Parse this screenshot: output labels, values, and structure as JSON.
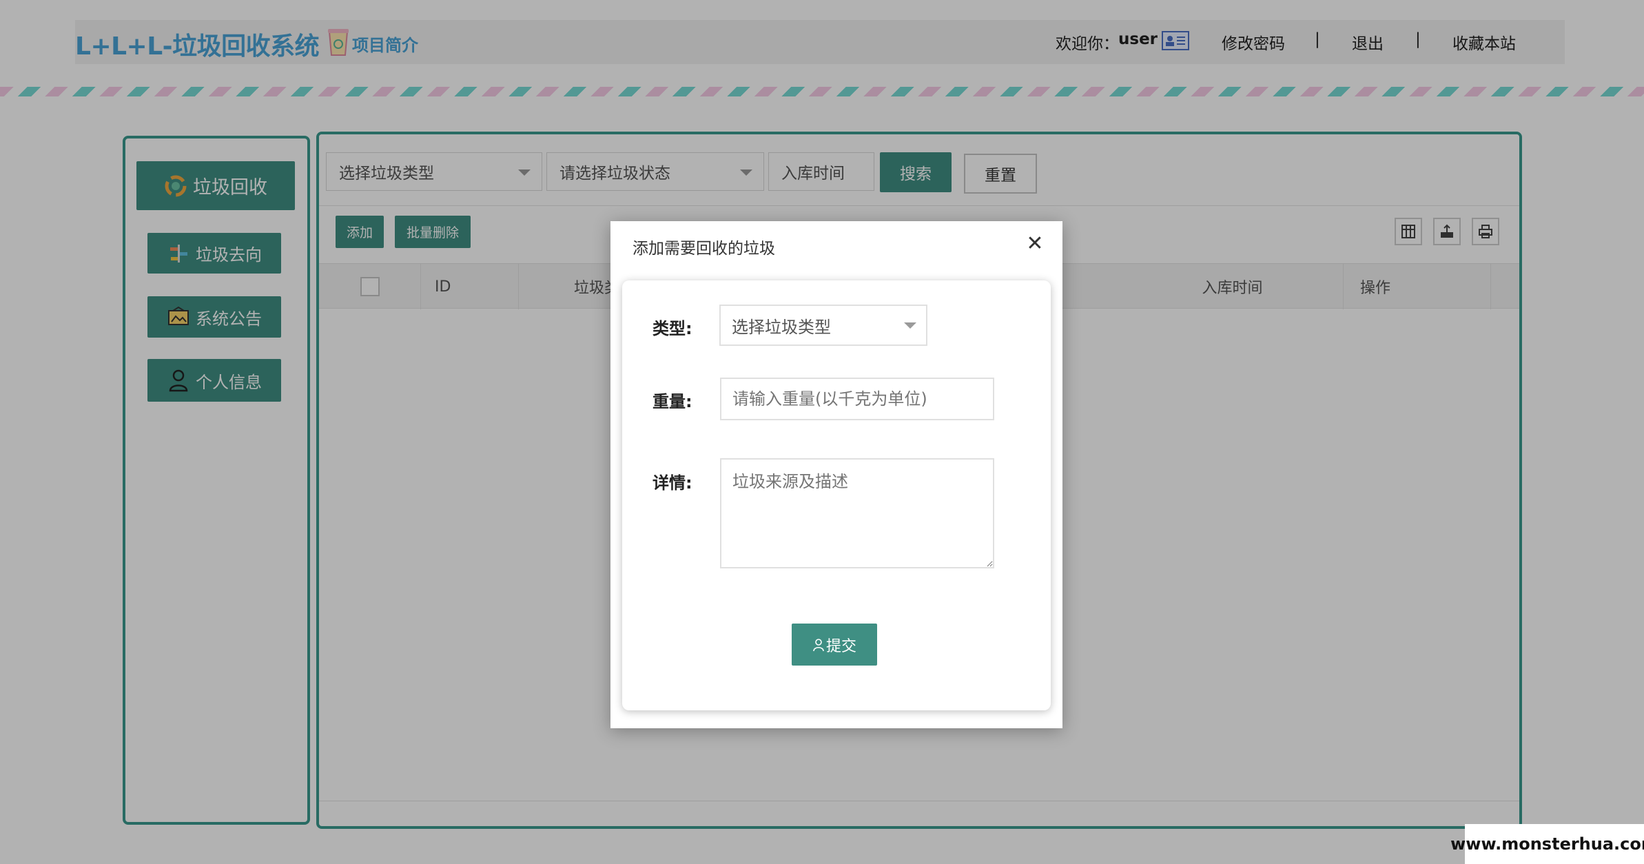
{
  "header": {
    "brand": "L+L+L-垃圾回收系统",
    "intro_link": "项目简介",
    "welcome": "欢迎你：",
    "user_name": "user",
    "change_password": "修改密码",
    "separator": "|",
    "logout": "退出",
    "bookmark": "收藏本站"
  },
  "sidebar": {
    "items": [
      {
        "label": "垃圾回收",
        "icon": "recycle-icon"
      },
      {
        "label": "垃圾去向",
        "icon": "signpost-icon"
      },
      {
        "label": "系统公告",
        "icon": "board-icon"
      },
      {
        "label": "个人信息",
        "icon": "user-icon"
      }
    ]
  },
  "filters": {
    "type_placeholder": "选择垃圾类型",
    "status_placeholder": "请选择垃圾状态",
    "date_placeholder": "入库时间",
    "search_label": "搜索",
    "reset_label": "重置"
  },
  "actions": {
    "add_label": "添加",
    "batch_delete_label": "批量删除"
  },
  "table": {
    "columns": [
      "ID",
      "垃圾类",
      "入库时间",
      "操作"
    ]
  },
  "modal": {
    "title": "添加需要回收的垃圾",
    "close": "✕",
    "type_label": "类型:",
    "type_placeholder": "选择垃圾类型",
    "weight_label": "重量:",
    "weight_placeholder": "请输入重量(以千克为单位)",
    "detail_label": "详情:",
    "detail_placeholder": "垃圾来源及描述",
    "submit_label": "提交"
  },
  "watermark": "www.monsterhua.com",
  "colors": {
    "brand": "#4aa3d6",
    "primary": "#3f8f83",
    "border": "#3a9a8e"
  }
}
